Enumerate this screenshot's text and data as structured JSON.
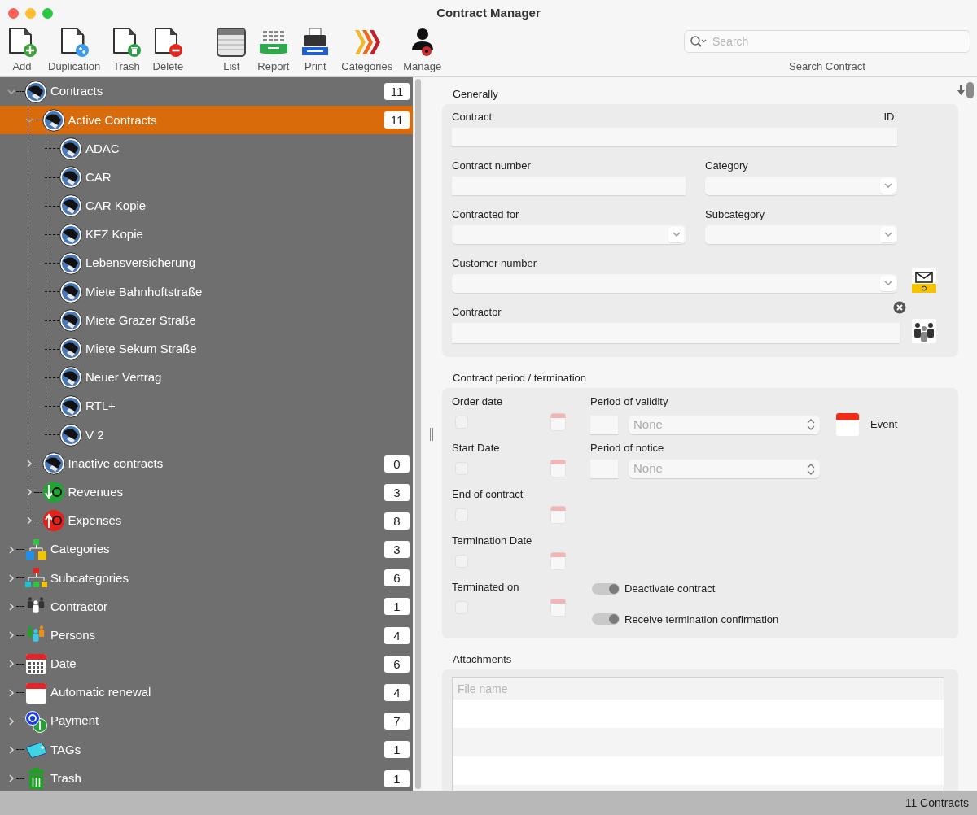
{
  "window": {
    "title": "Contract Manager"
  },
  "toolbar": {
    "groups": [
      [
        {
          "label": "Add"
        },
        {
          "label": "Duplication"
        },
        {
          "label": "Trash"
        },
        {
          "label": "Delete"
        }
      ],
      [
        {
          "label": "List"
        },
        {
          "label": "Report"
        },
        {
          "label": "Print"
        },
        {
          "label": "Categories"
        },
        {
          "label": "Manage"
        }
      ]
    ]
  },
  "search": {
    "placeholder": "Search",
    "caption": "Search Contract"
  },
  "sidebar": {
    "items": [
      {
        "label": "Contracts",
        "count": "11",
        "expanded": true,
        "selected": false,
        "children": [
          {
            "label": "Active Contracts",
            "count": "11",
            "expanded": true,
            "selected": true,
            "children": [
              {
                "label": "ADAC",
                "selected": false
              },
              {
                "label": "CAR",
                "selected": false
              },
              {
                "label": "CAR Kopie",
                "selected": false
              },
              {
                "label": "KFZ Kopie",
                "selected": false
              },
              {
                "label": "Lebensversicherung",
                "selected": false
              },
              {
                "label": "Miete Bahnhoftstraße",
                "selected": false
              },
              {
                "label": "Miete Grazer Straße",
                "selected": false
              },
              {
                "label": "Miete Sekum Straße",
                "selected": false
              },
              {
                "label": "Neuer Vertrag",
                "selected": false
              },
              {
                "label": "RTL+",
                "selected": false
              },
              {
                "label": "V 2",
                "selected": false
              }
            ]
          },
          {
            "label": "Inactive contracts",
            "count": "0",
            "expanded": false,
            "selected": false
          },
          {
            "label": "Revenues",
            "count": "3",
            "expanded": false,
            "selected": false
          },
          {
            "label": "Expenses",
            "count": "8",
            "expanded": false,
            "selected": false
          }
        ]
      },
      {
        "label": "Categories",
        "count": "3",
        "expanded": false,
        "selected": false
      },
      {
        "label": "Subcategories",
        "count": "6",
        "expanded": false,
        "selected": false
      },
      {
        "label": "Contractor",
        "count": "1",
        "expanded": false,
        "selected": false
      },
      {
        "label": "Persons",
        "count": "4",
        "expanded": false,
        "selected": false
      },
      {
        "label": "Date",
        "count": "6",
        "expanded": false,
        "selected": false
      },
      {
        "label": "Automatic renewal",
        "count": "4",
        "expanded": false,
        "selected": false
      },
      {
        "label": "Payment",
        "count": "7",
        "expanded": false,
        "selected": false
      },
      {
        "label": "TAGs",
        "count": "1",
        "expanded": false,
        "selected": false
      },
      {
        "label": "Trash",
        "count": "1",
        "expanded": false,
        "selected": false
      }
    ]
  },
  "general": {
    "title": "Generally",
    "contract": "Contract",
    "id_label": "ID:",
    "contract_number": "Contract number",
    "category": "Category",
    "contracted_for": "Contracted for",
    "subcategory": "Subcategory",
    "customer_number": "Customer number",
    "contractor": "Contractor"
  },
  "period": {
    "title": "Contract period / termination",
    "dates": [
      {
        "label": "Order date",
        "checked": false
      },
      {
        "label": "Start Date",
        "checked": false
      },
      {
        "label": "End of contract",
        "checked": false
      },
      {
        "label": "Termination Date",
        "checked": false
      },
      {
        "label": "Terminated on",
        "checked": false
      }
    ],
    "validity": {
      "label": "Period of validity",
      "value": "None"
    },
    "notice": {
      "label": "Period of notice",
      "value": "None"
    },
    "event": {
      "label": "Event"
    },
    "switches": [
      {
        "label": "Deactivate contract",
        "on": true
      },
      {
        "label": "Receive termination confirmation",
        "on": true
      }
    ]
  },
  "attachments": {
    "title": "Attachments",
    "columns": [
      "File name"
    ]
  },
  "status_bar": {
    "text": "11 Contracts"
  }
}
